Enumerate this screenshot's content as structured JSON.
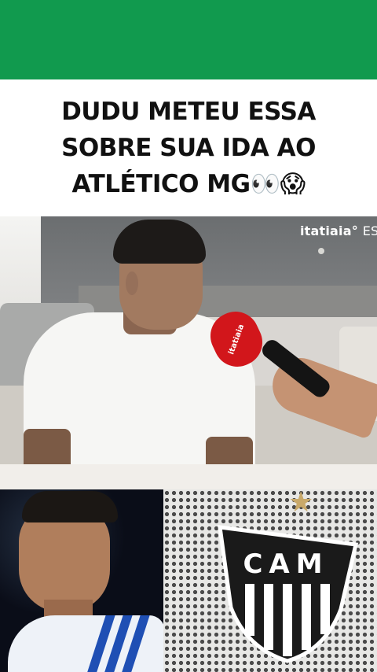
{
  "colors": {
    "top_bar": "#119a4e",
    "headline_text": "#111111",
    "mic_red": "#d2161b",
    "jersey_blue": "#1f4fb4"
  },
  "headline": {
    "lines": [
      "DUDU METEU ESSA",
      "SOBRE SUA IDA AO",
      "ATLÉTICO MG👀😱"
    ]
  },
  "video": {
    "watermark": "itatiaia",
    "watermark_suffix": "ESI",
    "mic_brand": "itatiaia"
  },
  "crest": {
    "letters": "CAM"
  }
}
